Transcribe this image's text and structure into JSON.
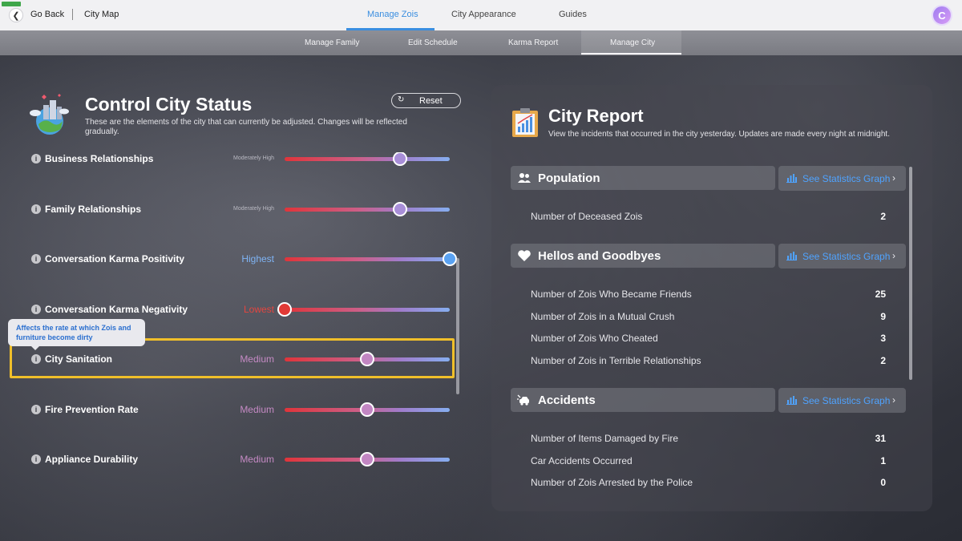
{
  "topbar": {
    "go_back": "Go Back",
    "city_map": "City Map",
    "tabs": [
      {
        "label": "Manage Zois",
        "active": true
      },
      {
        "label": "City Appearance",
        "active": false
      },
      {
        "label": "Guides",
        "active": false
      }
    ],
    "avatar_letter": "C"
  },
  "subtabs": [
    {
      "label": "Manage Family",
      "active": false
    },
    {
      "label": "Edit Schedule",
      "active": false
    },
    {
      "label": "Karma Report",
      "active": false
    },
    {
      "label": "Manage City",
      "active": true
    }
  ],
  "control": {
    "title": "Control City Status",
    "description": "These are the elements of the city that can currently be adjusted. Changes will be reflected gradually.",
    "reset_label": "Reset",
    "tooltip": "Affects the rate at which Zois and furniture become dirty",
    "sliders": [
      {
        "label": "Business Relationships",
        "value_text": "Moderately High",
        "level": 0.7,
        "value_color": "#b9b9c2",
        "thumb_color": "#a88ed8"
      },
      {
        "label": "Family Relationships",
        "value_text": "Moderately High",
        "level": 0.7,
        "value_color": "#b9b9c2",
        "thumb_color": "#a88ed8"
      },
      {
        "label": "Conversation Karma Positivity",
        "value_text": "Highest",
        "level": 1.0,
        "value_color": "#7fb4f5",
        "thumb_color": "#5aa2f2"
      },
      {
        "label": "Conversation Karma Negativity",
        "value_text": "Lowest",
        "level": 0.0,
        "value_color": "#e5453f",
        "thumb_color": "#e23a36"
      },
      {
        "label": "City Sanitation",
        "value_text": "Medium",
        "level": 0.5,
        "value_color": "#c58ac4",
        "thumb_color": "#c286c3"
      },
      {
        "label": "Fire Prevention Rate",
        "value_text": "Medium",
        "level": 0.5,
        "value_color": "#c58ac4",
        "thumb_color": "#c286c3"
      },
      {
        "label": "Appliance Durability",
        "value_text": "Medium",
        "level": 0.5,
        "value_color": "#c58ac4",
        "thumb_color": "#c286c3"
      }
    ]
  },
  "report": {
    "title": "City Report",
    "description": "View the incidents that occurred in the city yesterday. Updates are made every night at midnight.",
    "stats_button_label": "See Statistics Graph",
    "sections": [
      {
        "title": "Population",
        "icon": "people-icon",
        "rows": [
          {
            "label": "Number of Deceased Zois",
            "value": "2"
          }
        ]
      },
      {
        "title": "Hellos and Goodbyes",
        "icon": "heart-icon",
        "rows": [
          {
            "label": "Number of Zois Who Became Friends",
            "value": "25"
          },
          {
            "label": "Number of Zois in a Mutual Crush",
            "value": "9"
          },
          {
            "label": "Number of Zois Who Cheated",
            "value": "3"
          },
          {
            "label": "Number of Zois in Terrible Relationships",
            "value": "2"
          }
        ]
      },
      {
        "title": "Accidents",
        "icon": "car-crash-icon",
        "rows": [
          {
            "label": "Number of Items Damaged by Fire",
            "value": "31"
          },
          {
            "label": "Car Accidents Occurred",
            "value": "1"
          },
          {
            "label": "Number of Zois Arrested by the Police",
            "value": "0"
          }
        ]
      }
    ]
  }
}
